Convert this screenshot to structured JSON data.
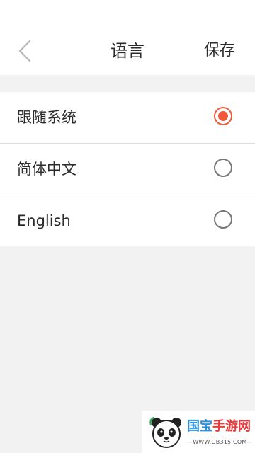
{
  "header": {
    "title": "语言",
    "save_label": "保存",
    "back_icon": "chevron-left-icon"
  },
  "options": [
    {
      "label": "跟随系统",
      "selected": true
    },
    {
      "label": "简体中文",
      "selected": false
    },
    {
      "label": "English",
      "selected": false
    }
  ],
  "colors": {
    "accent": "#f05a3c",
    "background": "#f2f2f2",
    "surface": "#ffffff",
    "text": "#2b2b2b",
    "divider": "#dcdcdc"
  },
  "watermark": {
    "brand_part1": "国宝",
    "brand_part2": "手游网",
    "url": "—WWW.GB315.COM—",
    "icon": "panda-icon"
  }
}
